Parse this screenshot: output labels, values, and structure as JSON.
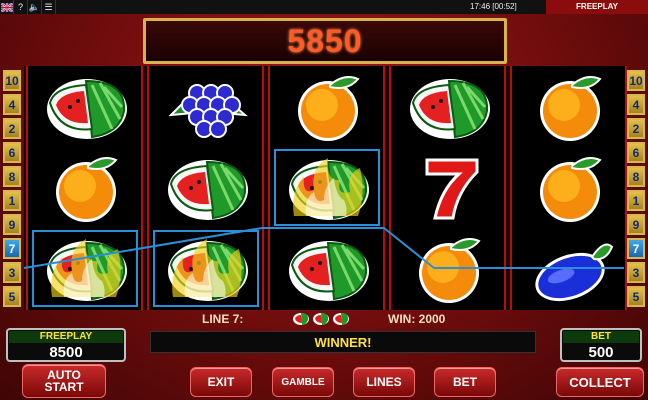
{
  "topbar": {
    "flag_icon": "uk-flag-icon",
    "help": "?",
    "sound_icon": "speaker-icon",
    "settings_icon": "menu-icon",
    "time": "17:46 [00:52]",
    "mode": "FREEPLAY"
  },
  "win_display": "5850",
  "lines_left": [
    "10",
    "4",
    "2",
    "6",
    "8",
    "1",
    "9",
    "7",
    "3",
    "5"
  ],
  "lines_right": [
    "10",
    "4",
    "2",
    "6",
    "8",
    "1",
    "9",
    "7",
    "3",
    "5"
  ],
  "active_line": "7",
  "reels": [
    [
      "watermelon",
      "orange",
      "watermelon-burning"
    ],
    [
      "grapes",
      "watermelon",
      "watermelon-burning"
    ],
    [
      "orange",
      "watermelon-burning",
      "watermelon"
    ],
    [
      "watermelon",
      "seven",
      "orange"
    ],
    [
      "orange",
      "orange",
      "plum"
    ]
  ],
  "info": {
    "line_label": "LINE 7:",
    "win_label": "WIN: 2000",
    "mini_icon": "watermelon-icon"
  },
  "message": "WINNER!",
  "freeplay": {
    "label": "FREEPLAY",
    "value": "8500"
  },
  "bet": {
    "label": "BET",
    "value": "500"
  },
  "buttons": {
    "auto_start": "AUTO\nSTART",
    "exit": "EXIT",
    "gamble": "GAMBLE",
    "lines": "LINES",
    "bet": "BET",
    "collect": "COLLECT"
  },
  "colors": {
    "accent": "#ffe13a",
    "win_line": "#2a8fd6",
    "win_digits": "#ff5a2a"
  }
}
